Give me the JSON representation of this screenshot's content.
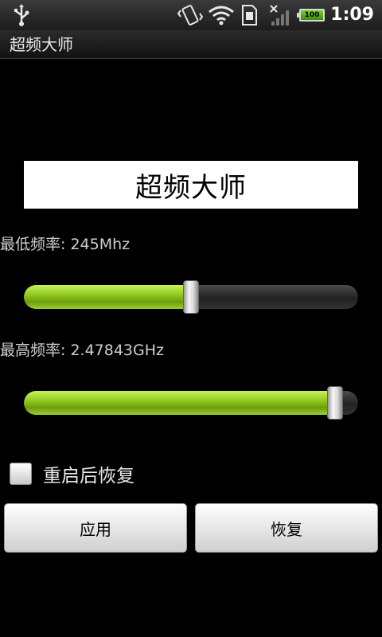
{
  "status_bar": {
    "time": "1:09",
    "battery_level": "100",
    "icons": [
      "usb-icon",
      "vibrate-icon",
      "wifi-icon",
      "sim-icon",
      "signal-icon",
      "battery-icon"
    ]
  },
  "title_bar": {
    "title": "超频大师"
  },
  "header": {
    "title": "超频大师"
  },
  "min_frequency": {
    "label": "最低频率:  245Mhz",
    "slider_fraction": 0.5
  },
  "max_frequency": {
    "label": "最高频率:  2.47843GHz",
    "slider_fraction": 0.93
  },
  "restore_on_reboot": {
    "label": "重启后恢复",
    "checked": false
  },
  "buttons": {
    "apply": "应用",
    "restore": "恢复"
  },
  "colors": {
    "slider_fill": "#8cc41a",
    "background": "#000000"
  }
}
